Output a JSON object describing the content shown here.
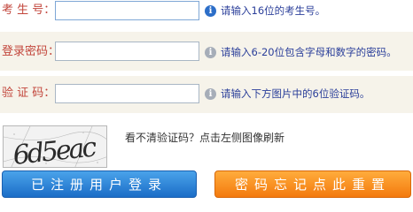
{
  "form": {
    "exam_id": {
      "label": "考 生 号：",
      "value": "",
      "hint": "请输入16位的考生号。"
    },
    "password": {
      "label": "登录密码：",
      "value": "",
      "hint": "请输入6-20位包含字母和数字的密码。"
    },
    "captcha": {
      "label": "验 证 码：",
      "value": "",
      "hint": "请输入下方图片中的6位验证码。"
    }
  },
  "captcha_image": {
    "text": "6d5eac",
    "note": "看不清验证码？点击左侧图像刷新"
  },
  "buttons": {
    "registered_login": "已注册用户登录",
    "forgot_password": "密码忘记点此重置"
  },
  "icons": {
    "info_active": "info-circle-icon",
    "info_inactive": "info-circle-icon"
  },
  "colors": {
    "label": "#c2453b",
    "hint": "#2b3f9a",
    "login_button": "#2a7fd6",
    "reset_button": "#f58d1f"
  }
}
